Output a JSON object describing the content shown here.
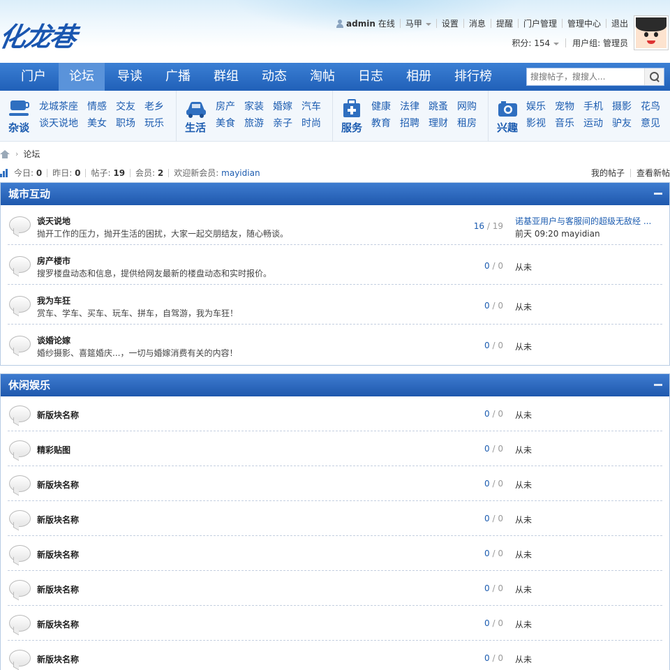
{
  "header": {
    "logo_text": "化龙巷",
    "username": "admin",
    "online_status": "在线",
    "user_menu": "马甲",
    "links": [
      "设置",
      "消息",
      "提醒",
      "门户管理",
      "管理中心",
      "退出"
    ],
    "points_label": "积分: 154",
    "usergroup_label": "用户组: 管理员"
  },
  "nav": {
    "items": [
      "门户",
      "论坛",
      "导读",
      "广播",
      "群组",
      "动态",
      "淘帖",
      "日志",
      "相册",
      "排行榜"
    ],
    "active_index": 1,
    "search_placeholder": "搜搜帖子，搜搜人..."
  },
  "categories": [
    {
      "title": "杂谈",
      "icon": "cup-icon",
      "links": [
        "龙城茶座",
        "情感",
        "交友",
        "老乡",
        "谈天说地",
        "美女",
        "职场",
        "玩乐"
      ]
    },
    {
      "title": "生活",
      "icon": "car-icon",
      "links": [
        "房产",
        "家装",
        "婚嫁",
        "汽车",
        "美食",
        "旅游",
        "亲子",
        "时尚"
      ]
    },
    {
      "title": "服务",
      "icon": "medkit-icon",
      "links": [
        "健康",
        "法律",
        "跳蚤",
        "网购",
        "教育",
        "招聘",
        "理财",
        "租房"
      ]
    },
    {
      "title": "兴趣",
      "icon": "camera-icon",
      "links": [
        "娱乐",
        "宠物",
        "手机",
        "摄影",
        "花鸟",
        "影视",
        "音乐",
        "运动",
        "驴友",
        "意见"
      ]
    }
  ],
  "breadcrumb": {
    "current": "论坛"
  },
  "stats": {
    "today_label": "今日:",
    "today": "0",
    "yesterday_label": "昨日:",
    "yesterday": "0",
    "posts_label": "帖子:",
    "posts": "19",
    "members_label": "会员:",
    "members": "2",
    "welcome_label": "欢迎新会员:",
    "new_member": "mayidian"
  },
  "quicklinks": [
    "我的帖子",
    "查看新帖"
  ],
  "sections": [
    {
      "title": "城市互动",
      "forums": [
        {
          "name": "谈天说地",
          "desc": "抛开工作的压力，抛开生活的困扰，大家一起交朋结友，随心畅谈。",
          "threads": "16",
          "posts": "19",
          "last_title": "诺基亚用户与客服间的超级无敌经 ...",
          "last_info": "前天 09:20 mayidian"
        },
        {
          "name": "房产楼市",
          "desc": "搜罗楼盘动态和信息，提供给网友最新的楼盘动态和实时报价。",
          "threads": "0",
          "posts": "0",
          "last_info": "从未"
        },
        {
          "name": "我为车狂",
          "desc": "赏车、学车、买车、玩车、拼车，自驾游，我为车狂！",
          "threads": "0",
          "posts": "0",
          "last_info": "从未"
        },
        {
          "name": "谈婚论嫁",
          "desc": "婚纱摄影、喜筵婚庆...，一切与婚嫁消费有关的内容！",
          "threads": "0",
          "posts": "0",
          "last_info": "从未"
        }
      ]
    },
    {
      "title": "休闲娱乐",
      "forums": [
        {
          "name": "新版块名称",
          "threads": "0",
          "posts": "0",
          "last_info": "从未"
        },
        {
          "name": "精彩贴图",
          "threads": "0",
          "posts": "0",
          "last_info": "从未"
        },
        {
          "name": "新版块名称",
          "threads": "0",
          "posts": "0",
          "last_info": "从未"
        },
        {
          "name": "新版块名称",
          "threads": "0",
          "posts": "0",
          "last_info": "从未"
        },
        {
          "name": "新版块名称",
          "threads": "0",
          "posts": "0",
          "last_info": "从未"
        },
        {
          "name": "新版块名称",
          "threads": "0",
          "posts": "0",
          "last_info": "从未"
        },
        {
          "name": "新版块名称",
          "threads": "0",
          "posts": "0",
          "last_info": "从未"
        },
        {
          "name": "新版块名称",
          "threads": "0",
          "posts": "0",
          "last_info": "从未"
        }
      ]
    }
  ],
  "colors": {
    "nav": "#2a6cc4",
    "link": "#1c5cb0",
    "section_head": "#2f6bc2"
  }
}
